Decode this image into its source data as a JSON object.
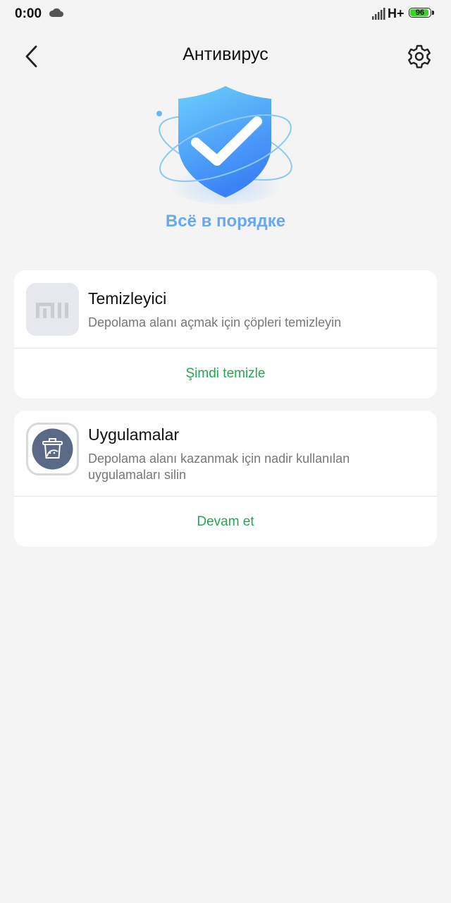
{
  "status_bar": {
    "time": "0:00",
    "network": "H+",
    "battery_level": "96",
    "icons": [
      "cloud-icon",
      "signal-icon",
      "battery-icon"
    ]
  },
  "header": {
    "title": "Антивирус",
    "back_icon": "chevron-left-icon",
    "settings_icon": "gear-icon"
  },
  "hero": {
    "status_text": "Всё в порядке",
    "icon": "shield-check-icon",
    "accent_color": "#6aa8f0"
  },
  "cards": [
    {
      "title": "Temizleyici",
      "description": "Depolama alanı açmak için çöpleri temizleyin",
      "action_label": "Şimdi temizle",
      "icon": "mi-logo-icon"
    },
    {
      "title": "Uygulamalar",
      "description": "Depolama alanı kazanmak için nadir kullanılan uygulamaları silin",
      "action_label": "Devam et",
      "icon": "app-trash-icon"
    }
  ],
  "colors": {
    "action_green": "#22a852",
    "background": "#f4f4f4"
  }
}
